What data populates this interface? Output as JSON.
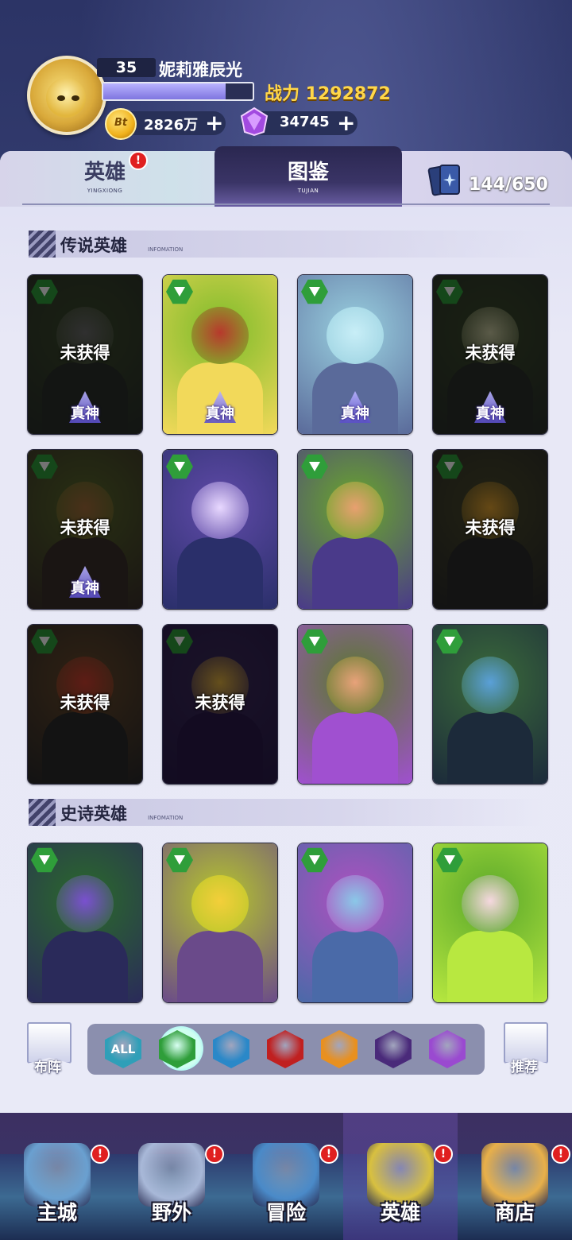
{
  "player": {
    "level": "35",
    "name": "妮莉雅辰光",
    "exp_fraction": 0.82,
    "power_label": "战力 1292872",
    "gold": "2826万",
    "gems": "34745",
    "gold_icon_text": "Bt",
    "plus": "+"
  },
  "tabs": [
    {
      "label": "英雄",
      "sub": "YINGXIONG",
      "badge": "!"
    },
    {
      "label": "图鉴",
      "sub": "TUJIAN"
    }
  ],
  "card_count": "144/650",
  "sections": [
    {
      "title": "传说英雄",
      "sub": "INFOMATION"
    },
    {
      "title": "史诗英雄",
      "sub": "INFOMATION"
    }
  ],
  "status_locked": "未获得",
  "rank_text": "真神",
  "legend_cards": [
    {
      "owned": false,
      "rank": true,
      "colors": [
        "#3b4a2a",
        "#6a6a6a",
        "#2a2f2a"
      ]
    },
    {
      "owned": true,
      "rank": true,
      "colors": [
        "#7dbb2a",
        "#b7392c",
        "#f2d95a"
      ]
    },
    {
      "owned": true,
      "rank": true,
      "colors": [
        "#9ad1e0",
        "#c8eef7",
        "#5a6a9a"
      ]
    },
    {
      "owned": false,
      "rank": true,
      "colors": [
        "#3a4a2a",
        "#c8c8a0",
        "#2a2f2a"
      ]
    },
    {
      "owned": false,
      "rank": true,
      "colors": [
        "#5a6a2a",
        "#a36a3a",
        "#3a2f2a"
      ]
    },
    {
      "owned": true,
      "rank": false,
      "colors": [
        "#5f4aa8",
        "#e8d8ff",
        "#2a2f6a"
      ]
    },
    {
      "owned": true,
      "rank": false,
      "colors": [
        "#6aa82a",
        "#e8a070",
        "#4a3a8a"
      ]
    },
    {
      "owned": false,
      "rank": false,
      "colors": [
        "#4a4a2a",
        "#e0a030",
        "#2a2a2a"
      ]
    },
    {
      "owned": false,
      "rank": false,
      "colors": [
        "#6a4a2a",
        "#d04030",
        "#2a2a2a"
      ]
    },
    {
      "owned": false,
      "rank": false,
      "colors": [
        "#3a2a5a",
        "#e0b040",
        "#2a1a4a"
      ]
    },
    {
      "owned": true,
      "rank": false,
      "colors": [
        "#5a7a2a",
        "#e8a27a",
        "#a050d0"
      ]
    },
    {
      "owned": true,
      "rank": false,
      "colors": [
        "#3a6a3a",
        "#5aa0d8",
        "#1c2a3a"
      ]
    }
  ],
  "epic_cards": [
    {
      "colors": [
        "#2a6a2a",
        "#7a50d0",
        "#2a2a5a"
      ]
    },
    {
      "colors": [
        "#b8c82a",
        "#f3cf3a",
        "#6a4a8a"
      ]
    },
    {
      "colors": [
        "#b050c0",
        "#8ac8e8",
        "#4a6aa8"
      ]
    },
    {
      "colors": [
        "#5aa82a",
        "#f6d8e0",
        "#b8e840"
      ]
    }
  ],
  "side_left": "布阵",
  "side_right": "推荐",
  "filters": [
    {
      "icon": "all-icon",
      "text": "ALL",
      "color": "#2f9fb8"
    },
    {
      "icon": "nature-element-icon",
      "text": "",
      "color": "#2f9e3a"
    },
    {
      "icon": "water-element-icon",
      "text": "",
      "color": "#2a88c8"
    },
    {
      "icon": "claw-element-icon",
      "text": "",
      "color": "#c02020"
    },
    {
      "icon": "light-element-icon",
      "text": "",
      "color": "#e89020"
    },
    {
      "icon": "dark-element-icon",
      "text": "",
      "color": "#4a2a7a"
    },
    {
      "icon": "arcane-element-icon",
      "text": "",
      "color": "#9a4ad0"
    }
  ],
  "nav": [
    {
      "label": "主城",
      "badge": "!",
      "color": "#6aa0d0"
    },
    {
      "label": "野外",
      "badge": "!",
      "color": "#a8b8d8"
    },
    {
      "label": "冒险",
      "badge": "!",
      "color": "#4a8ac8"
    },
    {
      "label": "英雄",
      "badge": "!",
      "color": "#d8c040"
    },
    {
      "label": "商店",
      "badge": "!",
      "color": "#e8b04a"
    }
  ]
}
